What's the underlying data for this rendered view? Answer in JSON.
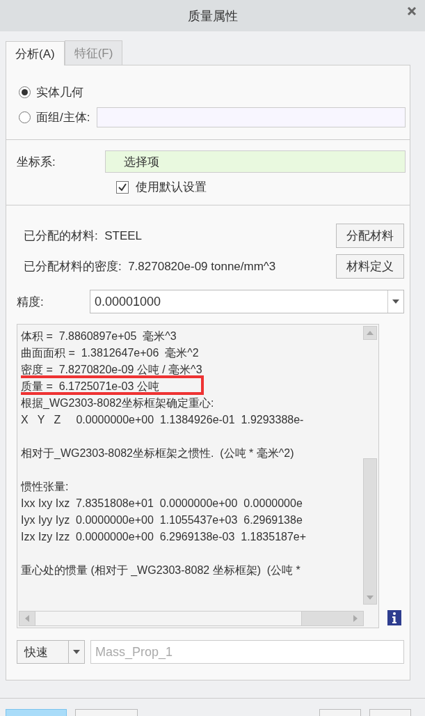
{
  "window": {
    "title": "质量属性"
  },
  "tabs": [
    {
      "label": "分析(A)",
      "selected": true
    },
    {
      "label": "特征(F)",
      "selected": false
    }
  ],
  "geometry": [
    {
      "label": "实体几何",
      "selected": true
    },
    {
      "label": "面组/主体:",
      "selected": false
    }
  ],
  "coordinate_system": {
    "label": "坐标系:",
    "value": "选择项",
    "use_default": {
      "label": "使用默认设置",
      "checked": true
    }
  },
  "material": {
    "assigned_label": "已分配的材料:",
    "assigned_value": "STEEL",
    "density_label": "已分配材料的密度:",
    "density_value": "7.8270820e-09  tonne/mm^3",
    "buttons": [
      "分配材料",
      "材料定义"
    ]
  },
  "precision": {
    "label": "精度:",
    "value": "0.00001000"
  },
  "results": {
    "paragraphs": [
      [
        {
          "text": "体积 =  7.8860897e+05  毫米^3",
          "highlighted": false
        },
        {
          "text": "曲面面积 =  1.3812647e+06  毫米^2",
          "highlighted": false
        },
        {
          "text": "密度 =  7.8270820e-09 公吨 / 毫米^3",
          "highlighted": false
        },
        {
          "text": "质量 =  6.1725071e-03 公吨",
          "highlighted": true
        },
        {
          "text": "根据_WG2303-8082坐标框架确定重心:",
          "highlighted": false
        },
        {
          "text": "X   Y   Z     0.0000000e+00  1.1384926e-01  1.9293388e-",
          "highlighted": false
        }
      ],
      [
        {
          "text": "相对于_WG2303-8082坐标框架之惯性.  (公吨 * 毫米^2)",
          "highlighted": false
        }
      ],
      [
        {
          "text": "惯性张量:",
          "highlighted": false
        },
        {
          "text": "Ixx Ixy Ixz  7.8351808e+01  0.0000000e+00  0.0000000e",
          "highlighted": false
        },
        {
          "text": "Iyx Iyy Iyz  0.0000000e+00  1.1055437e+03  6.2969138e",
          "highlighted": false
        },
        {
          "text": "Izx Izy Izz  0.0000000e+00  6.2969138e-03  1.1835187e+",
          "highlighted": false
        }
      ],
      [
        {
          "text": "重心处的惯量 (相对于 _WG2303-8082 坐标框架)  (公吨 *",
          "highlighted": false
        }
      ]
    ]
  },
  "footer": {
    "mode": "快速",
    "name_placeholder": "Mass_Prop_1"
  }
}
